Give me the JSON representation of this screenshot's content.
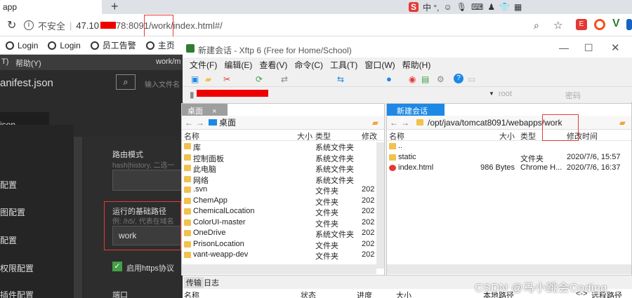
{
  "browser": {
    "tab_title": "app",
    "new_tab": "+",
    "url_insecure": "不安全",
    "url_prefix": "47.10",
    "url_suffix": "78:8091/",
    "url_highlight": "work",
    "url_path": "/index.html#/",
    "ime": {
      "brand": "S",
      "text": "中 °,"
    }
  },
  "bookmarks": [
    {
      "label": "Login"
    },
    {
      "label": "Login"
    },
    {
      "label": "员工告警"
    },
    {
      "label": "主页"
    }
  ],
  "darkapp": {
    "menu_left": "T)",
    "menu_help": "帮助(Y)",
    "menu_right": "work/m",
    "file_title": "anifest.json",
    "search_placeholder": "输入文件名",
    "tab_json": "json",
    "side_items": [
      "配置",
      "图配置",
      "配置",
      "权限配置",
      "插件配置"
    ],
    "route_mode_label": "路由模式",
    "route_mode_hint": "hash|history, 二选一",
    "base_path_label": "运行的基础路径",
    "base_path_hint": "例: /h5/, 代表在域名",
    "base_path_value": "work",
    "https_label": "启用https协议",
    "port_label": "端口"
  },
  "xftp": {
    "title": "新建会话 - Xftp 6 (Free for Home/School)",
    "menu": [
      "文件(F)",
      "编辑(E)",
      "查看(V)",
      "命令(C)",
      "工具(T)",
      "窗口(W)",
      "帮助(H)"
    ],
    "user_placeholder": "root",
    "pass_placeholder": "密码",
    "left": {
      "tab": "桌面",
      "path": "桌面",
      "cols": {
        "name": "名称",
        "size": "大小",
        "type": "类型",
        "mod": "修改"
      },
      "rows": [
        {
          "name": "库",
          "size": "",
          "type": "系统文件夹",
          "mod": ""
        },
        {
          "name": "控制面板",
          "size": "",
          "type": "系统文件夹",
          "mod": ""
        },
        {
          "name": "此电脑",
          "size": "",
          "type": "系统文件夹",
          "mod": ""
        },
        {
          "name": "网络",
          "size": "",
          "type": "系统文件夹",
          "mod": ""
        },
        {
          "name": ".svn",
          "size": "",
          "type": "文件夹",
          "mod": "202"
        },
        {
          "name": "ChemApp",
          "size": "",
          "type": "文件夹",
          "mod": "202"
        },
        {
          "name": "ChemicalLocation",
          "size": "",
          "type": "文件夹",
          "mod": "202"
        },
        {
          "name": "ColorUI-master",
          "size": "",
          "type": "文件夹",
          "mod": "202"
        },
        {
          "name": "OneDrive",
          "size": "",
          "type": "系统文件夹",
          "mod": "202"
        },
        {
          "name": "PrisonLocation",
          "size": "",
          "type": "文件夹",
          "mod": "202"
        },
        {
          "name": "vant-weapp-dev",
          "size": "",
          "type": "文件夹",
          "mod": "202"
        }
      ]
    },
    "right": {
      "tab": "新建会话",
      "path_prefix": "/opt/java/tomcat8091/webapps/",
      "path_highlight": "work",
      "cols": {
        "name": "名称",
        "size": "大小",
        "type": "类型",
        "mod": "修改时间"
      },
      "rows": [
        {
          "name": "..",
          "size": "",
          "type": "",
          "mod": ""
        },
        {
          "name": "static",
          "size": "",
          "type": "文件夹",
          "mod": "2020/7/6, 15:57"
        },
        {
          "name": "index.html",
          "size": "986 Bytes",
          "type": "Chrome H...",
          "mod": "2020/7/6, 16:37"
        }
      ]
    },
    "bottom": {
      "tab_transfer": "传输",
      "tab_log": "日志",
      "cols": [
        "名称",
        "状态",
        "进度",
        "大小",
        "本地路径",
        "<->",
        "远程路径"
      ]
    }
  },
  "watermark": "CSDN @马小跳会Coding",
  "colors": {
    "accent_blue": "#1e88e5",
    "redact": "#ee0000",
    "highlight": "#e53935"
  }
}
